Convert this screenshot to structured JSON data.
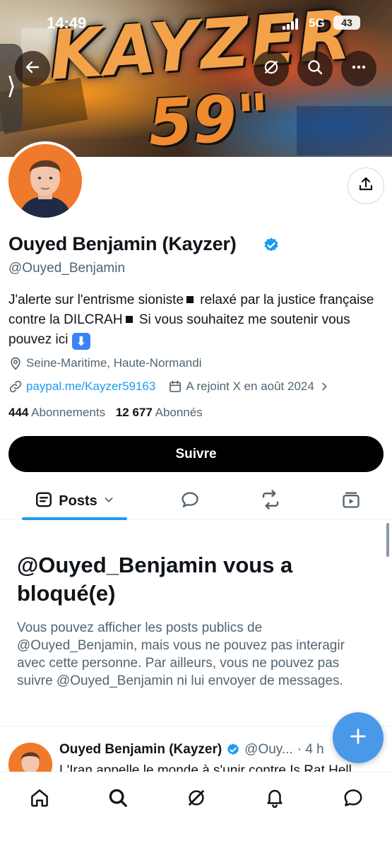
{
  "status_bar": {
    "time": "14:49",
    "network": "5G",
    "battery": "43"
  },
  "banner": {
    "graffiti_text_1": "KAYZER",
    "graffiti_text_2": "59\""
  },
  "profile": {
    "display_name": "Ouyed Benjamin (Kayzer)",
    "handle": "@Ouyed_Benjamin",
    "bio_part1": "J'alerte sur l'entrisme sioniste",
    "bio_part2": " relaxé par la justice française contre la DILCRAH",
    "bio_part3": " Si vous souhaitez me soutenir vous pouvez ici",
    "bio_emoji": "⬇",
    "location": "Seine-Maritime, Haute-Normandi",
    "website": "paypal.me/Kayzer59163",
    "joined": "A rejoint X en août 2024",
    "following_count": "444",
    "following_label": "Abonnements",
    "followers_count": "12 677",
    "followers_label": "Abonnés",
    "follow_button": "Suivre"
  },
  "tabs": {
    "posts_label": "Posts",
    "active": "posts"
  },
  "blocked": {
    "title": "@Ouyed_Benjamin vous a bloqué(e)",
    "description": "Vous pouvez afficher les posts publics de @Ouyed_Benjamin, mais vous ne pouvez pas interagir avec cette personne. Par ailleurs, vous ne pouvez pas suivre @Ouyed_Benjamin ni lui envoyer de messages."
  },
  "post_preview": {
    "name": "Ouyed Benjamin (Kayzer)",
    "handle": "@Ouy...",
    "time": "· 4 h",
    "text": "L'Iran appelle le monde à s'unir contre Is Rat Hell"
  },
  "colors": {
    "accent": "#1d9bf0",
    "verified": "#1d9bf0",
    "fab": "#4a99e9",
    "text_primary": "#0f1419",
    "text_secondary": "#536471"
  },
  "icons": {
    "back": "arrow-left-icon",
    "grok": "grok-icon",
    "search": "search-icon",
    "more": "more-horizontal-icon",
    "share": "share-icon",
    "location": "location-pin-icon",
    "link": "link-icon",
    "calendar": "calendar-icon",
    "compose": "plus-icon"
  }
}
